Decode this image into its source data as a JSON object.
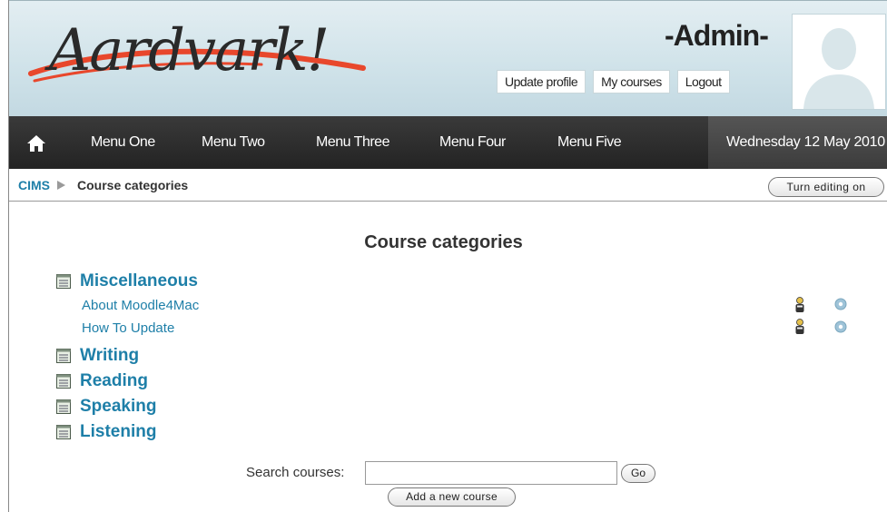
{
  "header": {
    "site_name": "Aardvark!",
    "user_name": "-Admin-",
    "usermenu": [
      "Update profile",
      "My courses",
      "Logout"
    ]
  },
  "nav": {
    "items": [
      "Menu One",
      "Menu Two",
      "Menu Three",
      "Menu Four",
      "Menu Five"
    ],
    "date": "Wednesday 12 May 2010"
  },
  "breadcrumb": {
    "home": "CIMS",
    "current": "Course categories",
    "edit_button": "Turn editing on"
  },
  "main": {
    "title": "Course categories",
    "categories": [
      {
        "name": "Miscellaneous",
        "courses": [
          "About Moodle4Mac",
          "How To Update"
        ]
      },
      {
        "name": "Writing"
      },
      {
        "name": "Reading"
      },
      {
        "name": "Speaking"
      },
      {
        "name": "Listening"
      }
    ]
  },
  "search": {
    "label": "Search courses:",
    "value": "",
    "go_button": "Go",
    "add_button": "Add a new course"
  },
  "colors": {
    "link": "#1e7fa8",
    "nav_bg": "#2b2b2b",
    "header_bg": "#cfe2e9"
  },
  "icons": [
    "home-icon",
    "category-icon",
    "teacher-icon",
    "info-icon",
    "breadcrumb-arrow-icon"
  ]
}
